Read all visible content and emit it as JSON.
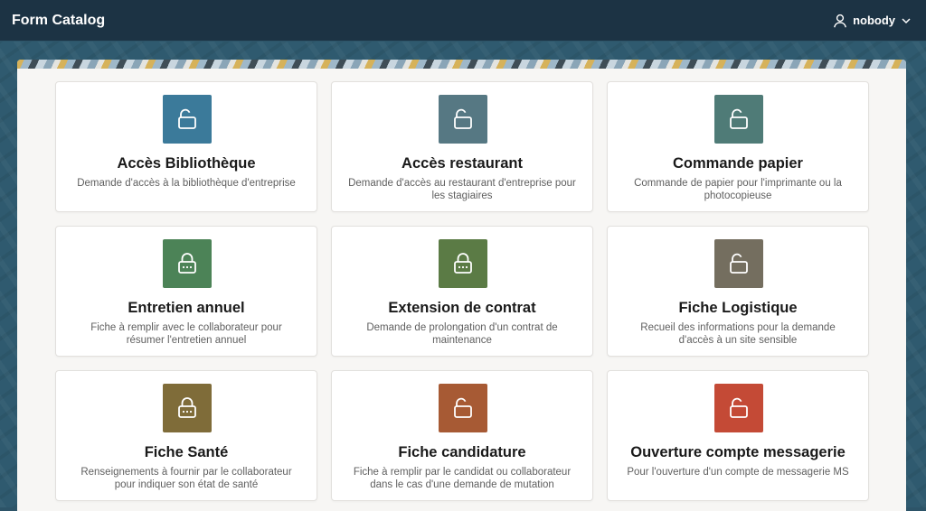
{
  "header": {
    "title": "Form Catalog",
    "user": "nobody"
  },
  "icons": {
    "user": "user-icon",
    "chevron": "chevron-down-icon"
  },
  "forms": [
    {
      "title": "Accès Bibliothèque",
      "description": "Demande d'accès à la bibliothèque d'entreprise",
      "icon": "unlocked-icon",
      "color": "#3b7a9a"
    },
    {
      "title": "Accès restaurant",
      "description": "Demande d'accès au restaurant d'entreprise pour les stagiaires",
      "icon": "unlocked-icon",
      "color": "#567883"
    },
    {
      "title": "Commande papier",
      "description": "Commande de papier pour l'imprimante ou la photocopieuse",
      "icon": "unlocked-icon",
      "color": "#4f7b77"
    },
    {
      "title": "Entretien annuel",
      "description": "Fiche à remplir avec le collaborateur pour résumer l'entretien annuel",
      "icon": "locked-icon",
      "color": "#4c8357"
    },
    {
      "title": "Extension de contrat",
      "description": "Demande de prolongation d'un contrat de maintenance",
      "icon": "locked-icon",
      "color": "#5b7b45"
    },
    {
      "title": "Fiche Logistique",
      "description": "Recueil des informations pour la demande d'accès à un site sensible",
      "icon": "unlocked-icon",
      "color": "#746e5f"
    },
    {
      "title": "Fiche Santé",
      "description": "Renseignements à fournir par le collaborateur pour indiquer son état de santé",
      "icon": "locked-icon",
      "color": "#7f6c39"
    },
    {
      "title": "Fiche candidature",
      "description": "Fiche à remplir par le candidat ou collaborateur dans le cas d'une demande de mutation",
      "icon": "unlocked-icon",
      "color": "#a75a34"
    },
    {
      "title": "Ouverture compte messagerie",
      "description": "Pour l'ouverture d'un compte de messagerie MS",
      "icon": "unlocked-icon",
      "color": "#c44a36"
    }
  ]
}
